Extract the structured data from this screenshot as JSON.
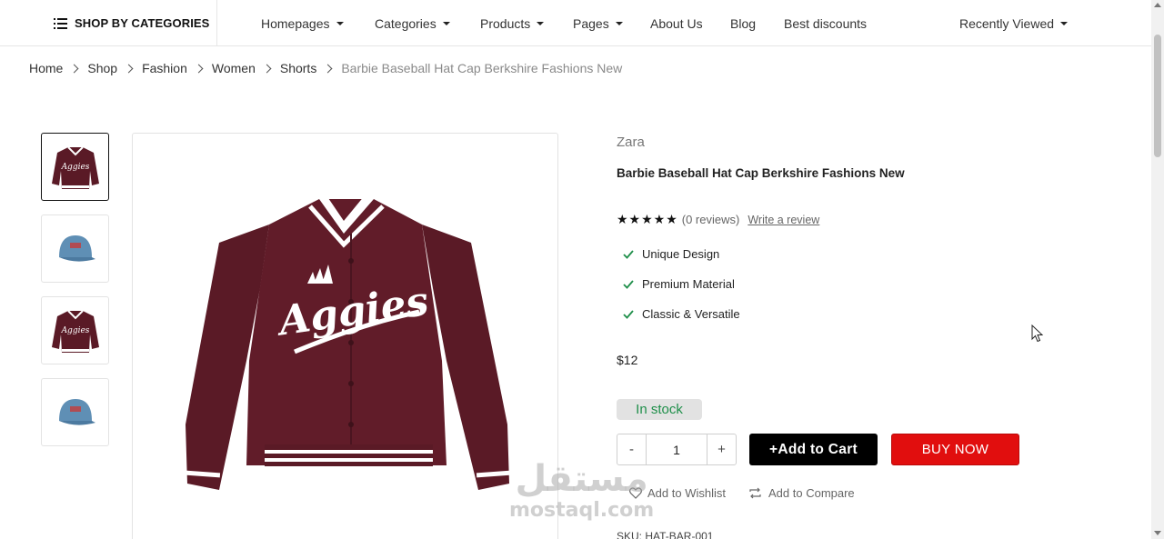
{
  "nav": {
    "categories_label": "SHOP BY CATEGORIES",
    "items": [
      {
        "label": "Homepages",
        "dropdown": true
      },
      {
        "label": "Categories",
        "dropdown": true
      },
      {
        "label": "Products",
        "dropdown": true
      },
      {
        "label": "Pages",
        "dropdown": true
      },
      {
        "label": "About Us",
        "dropdown": false
      },
      {
        "label": "Blog",
        "dropdown": false
      },
      {
        "label": "Best discounts",
        "dropdown": false
      }
    ],
    "recently_viewed": "Recently Viewed"
  },
  "breadcrumb": [
    "Home",
    "Shop",
    "Fashion",
    "Women",
    "Shorts",
    "Barbie Baseball Hat Cap Berkshire Fashions New"
  ],
  "gallery": {
    "thumbnails": [
      "jacket",
      "cap",
      "jacket",
      "cap"
    ],
    "active_index": 0,
    "jacket_text": "Aggies"
  },
  "product": {
    "brand": "Zara",
    "title": "Barbie Baseball Hat Cap Berkshire Fashions New",
    "stars": "★★★★★",
    "reviews": "(0 reviews)",
    "write_review": "Write a review",
    "features": [
      "Unique Design",
      "Premium Material",
      "Classic & Versatile"
    ],
    "price": "$12",
    "stock": "In stock",
    "quantity": "1",
    "minus": "-",
    "plus": "+",
    "add_to_cart": "+Add to Cart",
    "buy_now": "BUY NOW",
    "wishlist": "Add to Wishlist",
    "compare": "Add to Compare",
    "sku": "SKU: HAT-BAR-001"
  },
  "watermark": {
    "arabic": "مستقل",
    "latin": "mostaql.com"
  },
  "colors": {
    "accent_red": "#e10e0e",
    "stock_green": "#1f8f4a",
    "check_green": "#1f8f4a",
    "jacket": "#5a1a26"
  }
}
